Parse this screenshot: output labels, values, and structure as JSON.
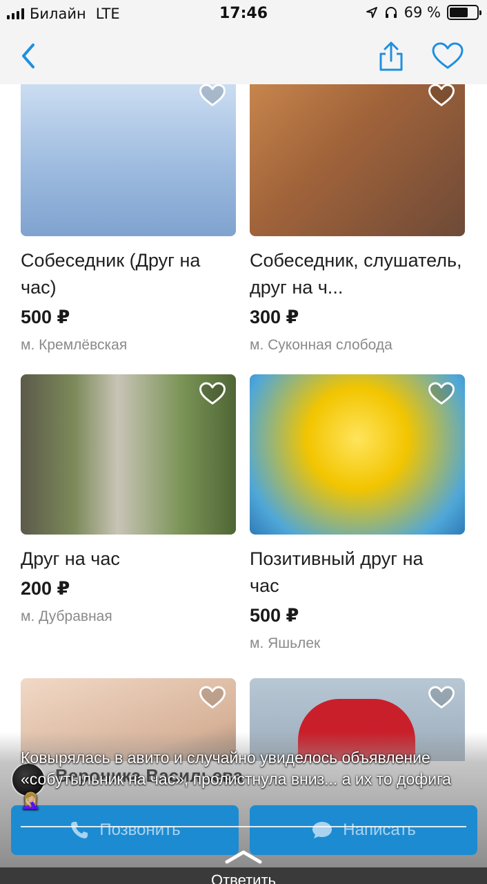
{
  "status_bar": {
    "carrier": "Билайн",
    "network": "LTE",
    "time": "17:46",
    "battery_percent": 69,
    "battery_label": "69 %"
  },
  "nav": {
    "back_icon": "chevron-left-icon",
    "share_icon": "share-icon",
    "favorite_icon": "heart-icon",
    "accent_color": "#1e8fe1"
  },
  "listings": [
    {
      "title": "Собеседник (Друг на час)",
      "price": "500 ₽",
      "metro": "м. Кремлёвская",
      "image": "business-meeting-photo"
    },
    {
      "title": "Собеседник, слушатель, друг на ч...",
      "price": "300 ₽",
      "metro": "м. Суконная слобода",
      "image": "woman-with-dog-photo"
    },
    {
      "title": "Друг на час",
      "price": "200 ₽",
      "metro": "м. Дубравная",
      "image": "woman-by-tree-photo"
    },
    {
      "title": "Позитивный друг на час",
      "price": "500 ₽",
      "metro": "м. Яшьлек",
      "image": "child-in-flowers-photo"
    },
    {
      "title": "",
      "price": "",
      "metro": "",
      "image": "hands-photo"
    },
    {
      "title": "",
      "price": "",
      "metro": "",
      "image": "man-in-red-jacket-photo"
    }
  ],
  "seller": {
    "name": "Вероника Васильева"
  },
  "actions": {
    "call_label": "Позвонить",
    "message_label": "Написать"
  },
  "caption": "Ковырялась в авито и случайно увиделось объявление «собутыльник на час», пролистнула вниз... а их то дофига 🤦🏼‍♀️",
  "reply": {
    "label": "Ответить"
  }
}
